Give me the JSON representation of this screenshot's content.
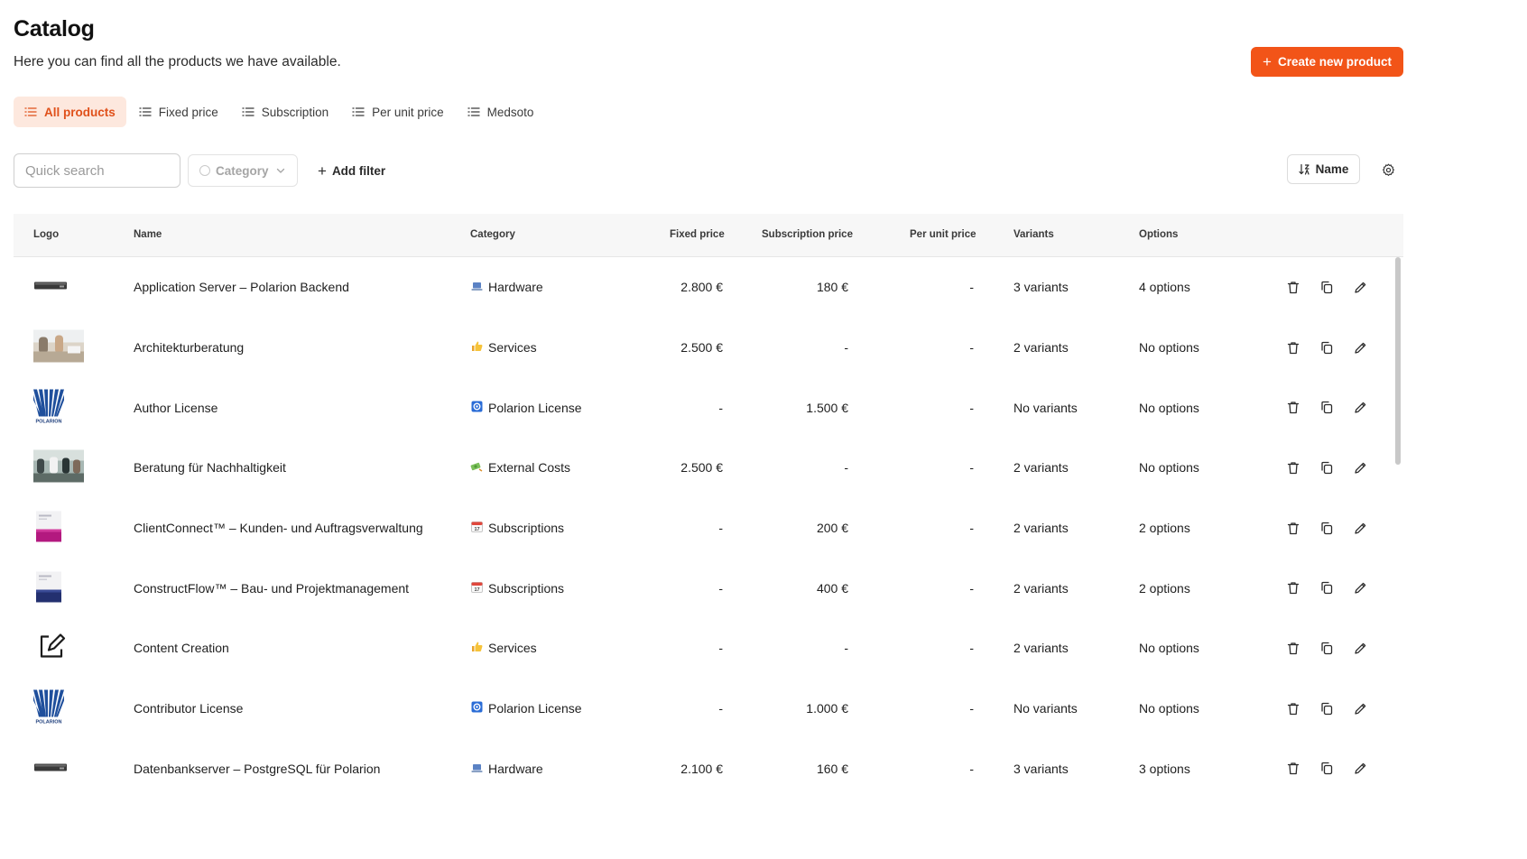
{
  "page": {
    "title": "Catalog",
    "subtitle": "Here you can find all the products we have available.",
    "create_button": "Create new product"
  },
  "tabs": [
    {
      "label": "All products",
      "active": true
    },
    {
      "label": "Fixed price",
      "active": false
    },
    {
      "label": "Subscription",
      "active": false
    },
    {
      "label": "Per unit price",
      "active": false
    },
    {
      "label": "Medsoto",
      "active": false
    }
  ],
  "toolbar": {
    "search_placeholder": "Quick search",
    "category_label": "Category",
    "add_filter_label": "Add filter",
    "sort_label": "Name"
  },
  "table": {
    "columns": [
      "Logo",
      "Name",
      "Category",
      "Fixed price",
      "Subscription price",
      "Per unit price",
      "Variants",
      "Options"
    ],
    "rows": [
      {
        "logo": "server",
        "name": "Application Server – Polarion Backend",
        "category_icon": "laptop",
        "category": "Hardware",
        "fixed": "2.800 €",
        "subscription": "180 €",
        "per_unit": "-",
        "variants": "3 variants",
        "options": "4 options"
      },
      {
        "logo": "photo-office",
        "name": "Architekturberatung",
        "category_icon": "thumbs-up",
        "category": "Services",
        "fixed": "2.500 €",
        "subscription": "-",
        "per_unit": "-",
        "variants": "2 variants",
        "options": "No options"
      },
      {
        "logo": "polarion",
        "name": "Author License",
        "category_icon": "polarion-badge",
        "category": "Polarion License",
        "fixed": "-",
        "subscription": "1.500 €",
        "per_unit": "-",
        "variants": "No variants",
        "options": "No options"
      },
      {
        "logo": "photo-meeting",
        "name": "Beratung für Nachhaltigkeit",
        "category_icon": "money",
        "category": "External Costs",
        "fixed": "2.500 €",
        "subscription": "-",
        "per_unit": "-",
        "variants": "2 variants",
        "options": "No options"
      },
      {
        "logo": "box-magenta",
        "name": "ClientConnect™ – Kunden- und Auftragsverwaltung",
        "category_icon": "calendar",
        "category": "Subscriptions",
        "fixed": "-",
        "subscription": "200 €",
        "per_unit": "-",
        "variants": "2 variants",
        "options": "2 options"
      },
      {
        "logo": "box-navy",
        "name": "ConstructFlow™ – Bau- und Projektmanagement",
        "category_icon": "calendar",
        "category": "Subscriptions",
        "fixed": "-",
        "subscription": "400 €",
        "per_unit": "-",
        "variants": "2 variants",
        "options": "2 options"
      },
      {
        "logo": "edit-square",
        "name": "Content Creation",
        "category_icon": "thumbs-up",
        "category": "Services",
        "fixed": "-",
        "subscription": "-",
        "per_unit": "-",
        "variants": "2 variants",
        "options": "No options"
      },
      {
        "logo": "polarion",
        "name": "Contributor License",
        "category_icon": "polarion-badge",
        "category": "Polarion License",
        "fixed": "-",
        "subscription": "1.000 €",
        "per_unit": "-",
        "variants": "No variants",
        "options": "No options"
      },
      {
        "logo": "server",
        "name": "Datenbankserver – PostgreSQL für Polarion",
        "category_icon": "laptop",
        "category": "Hardware",
        "fixed": "2.100 €",
        "subscription": "160 €",
        "per_unit": "-",
        "variants": "3 variants",
        "options": "3 options"
      }
    ]
  },
  "colors": {
    "accent": "#f25418",
    "tab_active_bg": "#fde8de",
    "tab_active_text": "#e0501a",
    "header_bg": "#f7f7f7"
  }
}
